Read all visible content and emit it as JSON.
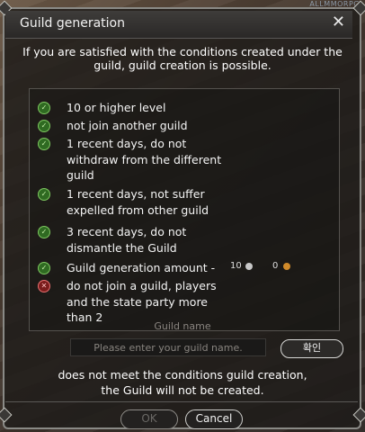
{
  "window": {
    "title": "Guild generation",
    "brand": "ALLMMORPG"
  },
  "intro": {
    "line1": "If you are satisfied with the conditions created under the",
    "line2": "guild, guild creation is possible."
  },
  "conditions": [
    {
      "text": "10 or higher level",
      "met": true
    },
    {
      "text": "not join another guild",
      "met": true
    },
    {
      "text": "1 recent days, do not withdraw from the different guild",
      "met": true
    },
    {
      "text": "1 recent days, not suffer expelled from other guild",
      "met": true
    },
    {
      "text": "3 recent days, do not dismantle the Guild",
      "met": true
    },
    {
      "text": "Guild generation amount -",
      "met": true
    },
    {
      "text": "do not join a guild, players and the state party more than 2",
      "met": false
    }
  ],
  "amount": {
    "silver": "10",
    "gold": "0"
  },
  "guild_name": {
    "label": "Guild name",
    "placeholder": "Please enter your guild name.",
    "confirm_label": "확인"
  },
  "warning": {
    "line1": "does not meet the conditions guild creation,",
    "line2": "the Guild will not be created."
  },
  "buttons": {
    "ok": "OK",
    "cancel": "Cancel"
  },
  "colors": {
    "check_green": "#2f6a22",
    "cross_red": "#7a1c1c",
    "silver_coin": "#c8c8c8",
    "gold_coin": "#d08a2a"
  }
}
